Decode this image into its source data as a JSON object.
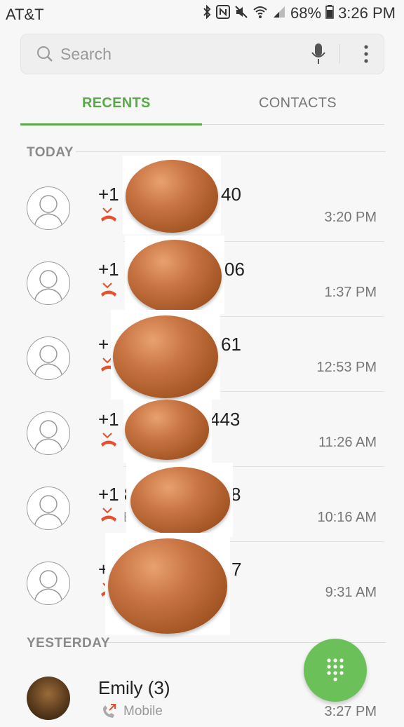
{
  "status": {
    "carrier": "AT&T",
    "battery": "68%",
    "time": "3:26 PM"
  },
  "search": {
    "placeholder": "Search"
  },
  "tabs": [
    {
      "label": "RECENTS"
    },
    {
      "label": "CONTACTS"
    }
  ],
  "sections": {
    "today": "TODAY",
    "yesterday": "YESTERDAY"
  },
  "calls": [
    {
      "name": "+1",
      "suffix": "40",
      "sub": "",
      "time": "3:20 PM"
    },
    {
      "name": "+1",
      "suffix": "06",
      "sub": "",
      "time": "1:37 PM"
    },
    {
      "name": "+",
      "suffix": "61",
      "sub": "",
      "time": "12:53 PM"
    },
    {
      "name": "+1",
      "suffix": "443",
      "sub": "",
      "time": "11:26 AM"
    },
    {
      "name": "+1 8",
      "suffix": "8",
      "sub": "E",
      "time": "10:16 AM"
    },
    {
      "name": "+",
      "suffix": "7",
      "sub": "",
      "time": "9:31 AM"
    }
  ],
  "yesterday": [
    {
      "name": "Emily (3)",
      "sub": "Mobile",
      "time": "3:27 PM"
    }
  ],
  "colors": {
    "accent": "#5aa84a",
    "missed": "#e8502d",
    "fab": "#6cc05a"
  }
}
